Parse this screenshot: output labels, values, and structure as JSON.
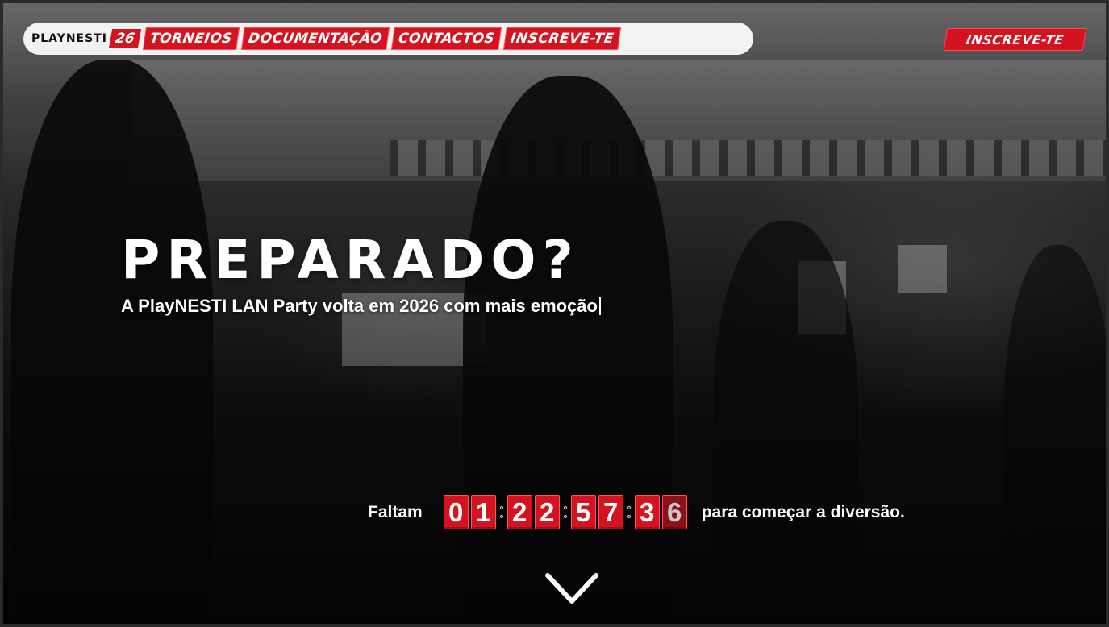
{
  "navbar": {
    "brand_name": "PLAYNESTI",
    "brand_year": "26",
    "links": [
      "TORNEIOS",
      "DOCUMENTAÇÃO",
      "CONTACTOS",
      "INSCREVE-TE"
    ]
  },
  "cta_top": "INSCREVE-TE",
  "hero": {
    "title": "PREPARADO?",
    "subtitle": "A PlayNESTI LAN Party volta em 2026 com mais emoção"
  },
  "countdown": {
    "prefix": "Faltam",
    "suffix": "para começar a diversão.",
    "groups": [
      [
        "0",
        "1"
      ],
      [
        "2",
        "2"
      ],
      [
        "5",
        "7"
      ],
      [
        "3",
        "6"
      ]
    ]
  },
  "icons": {
    "scroll": "chevron-down-icon"
  },
  "colors": {
    "accent": "#d51320",
    "nav_bg": "#f2f2f2"
  }
}
